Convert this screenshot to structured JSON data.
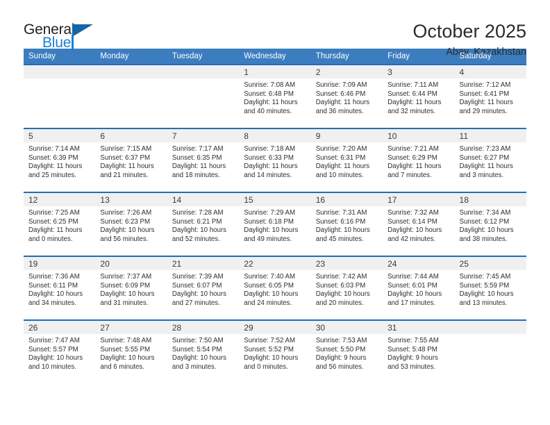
{
  "brand": {
    "word_one": "General",
    "word_two": "Blue",
    "triangle_icon": "triangle-icon",
    "accent_blue": "#1a7fd4",
    "dark_blue": "#1565a8"
  },
  "header": {
    "title": "October 2025",
    "location": "Abay, Kazakhstan"
  },
  "calendar": {
    "header_bg": "#3b7dbf",
    "cell_border": "#1f6fb5",
    "daynum_bg": "#f0f0f0",
    "weekdays": [
      "Sunday",
      "Monday",
      "Tuesday",
      "Wednesday",
      "Thursday",
      "Friday",
      "Saturday"
    ],
    "weeks": [
      [
        {
          "day": "",
          "sunrise": "",
          "sunset": "",
          "daylight_line1": "",
          "daylight_line2": ""
        },
        {
          "day": "",
          "sunrise": "",
          "sunset": "",
          "daylight_line1": "",
          "daylight_line2": ""
        },
        {
          "day": "",
          "sunrise": "",
          "sunset": "",
          "daylight_line1": "",
          "daylight_line2": ""
        },
        {
          "day": "1",
          "sunrise": "Sunrise: 7:08 AM",
          "sunset": "Sunset: 6:48 PM",
          "daylight_line1": "Daylight: 11 hours",
          "daylight_line2": "and 40 minutes."
        },
        {
          "day": "2",
          "sunrise": "Sunrise: 7:09 AM",
          "sunset": "Sunset: 6:46 PM",
          "daylight_line1": "Daylight: 11 hours",
          "daylight_line2": "and 36 minutes."
        },
        {
          "day": "3",
          "sunrise": "Sunrise: 7:11 AM",
          "sunset": "Sunset: 6:44 PM",
          "daylight_line1": "Daylight: 11 hours",
          "daylight_line2": "and 32 minutes."
        },
        {
          "day": "4",
          "sunrise": "Sunrise: 7:12 AM",
          "sunset": "Sunset: 6:41 PM",
          "daylight_line1": "Daylight: 11 hours",
          "daylight_line2": "and 29 minutes."
        }
      ],
      [
        {
          "day": "5",
          "sunrise": "Sunrise: 7:14 AM",
          "sunset": "Sunset: 6:39 PM",
          "daylight_line1": "Daylight: 11 hours",
          "daylight_line2": "and 25 minutes."
        },
        {
          "day": "6",
          "sunrise": "Sunrise: 7:15 AM",
          "sunset": "Sunset: 6:37 PM",
          "daylight_line1": "Daylight: 11 hours",
          "daylight_line2": "and 21 minutes."
        },
        {
          "day": "7",
          "sunrise": "Sunrise: 7:17 AM",
          "sunset": "Sunset: 6:35 PM",
          "daylight_line1": "Daylight: 11 hours",
          "daylight_line2": "and 18 minutes."
        },
        {
          "day": "8",
          "sunrise": "Sunrise: 7:18 AM",
          "sunset": "Sunset: 6:33 PM",
          "daylight_line1": "Daylight: 11 hours",
          "daylight_line2": "and 14 minutes."
        },
        {
          "day": "9",
          "sunrise": "Sunrise: 7:20 AM",
          "sunset": "Sunset: 6:31 PM",
          "daylight_line1": "Daylight: 11 hours",
          "daylight_line2": "and 10 minutes."
        },
        {
          "day": "10",
          "sunrise": "Sunrise: 7:21 AM",
          "sunset": "Sunset: 6:29 PM",
          "daylight_line1": "Daylight: 11 hours",
          "daylight_line2": "and 7 minutes."
        },
        {
          "day": "11",
          "sunrise": "Sunrise: 7:23 AM",
          "sunset": "Sunset: 6:27 PM",
          "daylight_line1": "Daylight: 11 hours",
          "daylight_line2": "and 3 minutes."
        }
      ],
      [
        {
          "day": "12",
          "sunrise": "Sunrise: 7:25 AM",
          "sunset": "Sunset: 6:25 PM",
          "daylight_line1": "Daylight: 11 hours",
          "daylight_line2": "and 0 minutes."
        },
        {
          "day": "13",
          "sunrise": "Sunrise: 7:26 AM",
          "sunset": "Sunset: 6:23 PM",
          "daylight_line1": "Daylight: 10 hours",
          "daylight_line2": "and 56 minutes."
        },
        {
          "day": "14",
          "sunrise": "Sunrise: 7:28 AM",
          "sunset": "Sunset: 6:21 PM",
          "daylight_line1": "Daylight: 10 hours",
          "daylight_line2": "and 52 minutes."
        },
        {
          "day": "15",
          "sunrise": "Sunrise: 7:29 AM",
          "sunset": "Sunset: 6:18 PM",
          "daylight_line1": "Daylight: 10 hours",
          "daylight_line2": "and 49 minutes."
        },
        {
          "day": "16",
          "sunrise": "Sunrise: 7:31 AM",
          "sunset": "Sunset: 6:16 PM",
          "daylight_line1": "Daylight: 10 hours",
          "daylight_line2": "and 45 minutes."
        },
        {
          "day": "17",
          "sunrise": "Sunrise: 7:32 AM",
          "sunset": "Sunset: 6:14 PM",
          "daylight_line1": "Daylight: 10 hours",
          "daylight_line2": "and 42 minutes."
        },
        {
          "day": "18",
          "sunrise": "Sunrise: 7:34 AM",
          "sunset": "Sunset: 6:12 PM",
          "daylight_line1": "Daylight: 10 hours",
          "daylight_line2": "and 38 minutes."
        }
      ],
      [
        {
          "day": "19",
          "sunrise": "Sunrise: 7:36 AM",
          "sunset": "Sunset: 6:11 PM",
          "daylight_line1": "Daylight: 10 hours",
          "daylight_line2": "and 34 minutes."
        },
        {
          "day": "20",
          "sunrise": "Sunrise: 7:37 AM",
          "sunset": "Sunset: 6:09 PM",
          "daylight_line1": "Daylight: 10 hours",
          "daylight_line2": "and 31 minutes."
        },
        {
          "day": "21",
          "sunrise": "Sunrise: 7:39 AM",
          "sunset": "Sunset: 6:07 PM",
          "daylight_line1": "Daylight: 10 hours",
          "daylight_line2": "and 27 minutes."
        },
        {
          "day": "22",
          "sunrise": "Sunrise: 7:40 AM",
          "sunset": "Sunset: 6:05 PM",
          "daylight_line1": "Daylight: 10 hours",
          "daylight_line2": "and 24 minutes."
        },
        {
          "day": "23",
          "sunrise": "Sunrise: 7:42 AM",
          "sunset": "Sunset: 6:03 PM",
          "daylight_line1": "Daylight: 10 hours",
          "daylight_line2": "and 20 minutes."
        },
        {
          "day": "24",
          "sunrise": "Sunrise: 7:44 AM",
          "sunset": "Sunset: 6:01 PM",
          "daylight_line1": "Daylight: 10 hours",
          "daylight_line2": "and 17 minutes."
        },
        {
          "day": "25",
          "sunrise": "Sunrise: 7:45 AM",
          "sunset": "Sunset: 5:59 PM",
          "daylight_line1": "Daylight: 10 hours",
          "daylight_line2": "and 13 minutes."
        }
      ],
      [
        {
          "day": "26",
          "sunrise": "Sunrise: 7:47 AM",
          "sunset": "Sunset: 5:57 PM",
          "daylight_line1": "Daylight: 10 hours",
          "daylight_line2": "and 10 minutes."
        },
        {
          "day": "27",
          "sunrise": "Sunrise: 7:48 AM",
          "sunset": "Sunset: 5:55 PM",
          "daylight_line1": "Daylight: 10 hours",
          "daylight_line2": "and 6 minutes."
        },
        {
          "day": "28",
          "sunrise": "Sunrise: 7:50 AM",
          "sunset": "Sunset: 5:54 PM",
          "daylight_line1": "Daylight: 10 hours",
          "daylight_line2": "and 3 minutes."
        },
        {
          "day": "29",
          "sunrise": "Sunrise: 7:52 AM",
          "sunset": "Sunset: 5:52 PM",
          "daylight_line1": "Daylight: 10 hours",
          "daylight_line2": "and 0 minutes."
        },
        {
          "day": "30",
          "sunrise": "Sunrise: 7:53 AM",
          "sunset": "Sunset: 5:50 PM",
          "daylight_line1": "Daylight: 9 hours",
          "daylight_line2": "and 56 minutes."
        },
        {
          "day": "31",
          "sunrise": "Sunrise: 7:55 AM",
          "sunset": "Sunset: 5:48 PM",
          "daylight_line1": "Daylight: 9 hours",
          "daylight_line2": "and 53 minutes."
        },
        {
          "day": "",
          "sunrise": "",
          "sunset": "",
          "daylight_line1": "",
          "daylight_line2": ""
        }
      ]
    ]
  }
}
